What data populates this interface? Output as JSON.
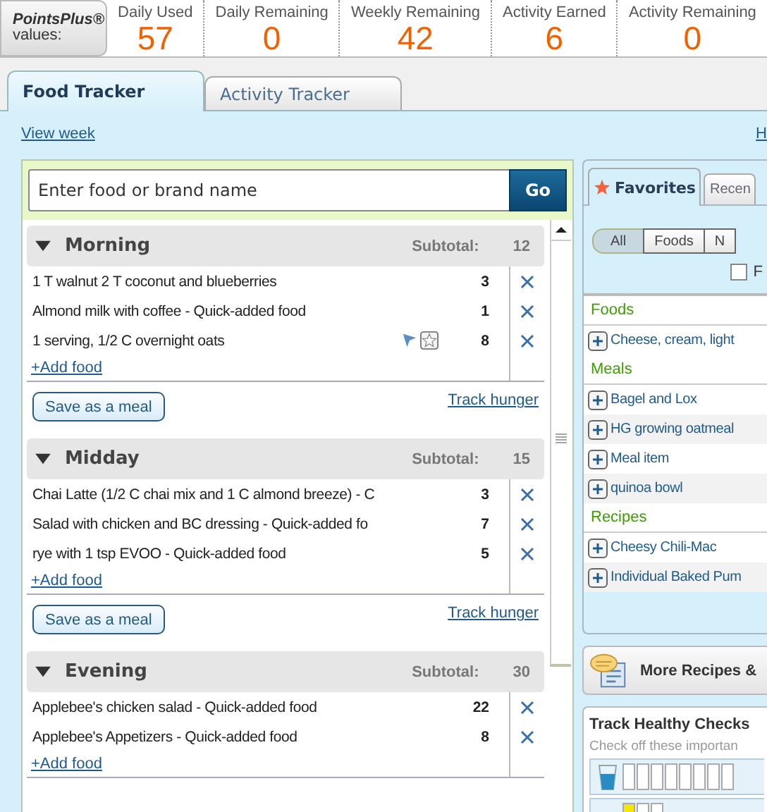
{
  "points_bar": {
    "brand": "PointsPlus®",
    "suffix": "values:",
    "stats": [
      {
        "label": "Daily Used",
        "value": "57"
      },
      {
        "label": "Daily Remaining",
        "value": "0"
      },
      {
        "label": "Weekly Remaining",
        "value": "42"
      },
      {
        "label": "Activity Earned",
        "value": "6"
      },
      {
        "label": "Activity Remaining",
        "value": "0"
      }
    ]
  },
  "tabs": [
    {
      "label": "Food Tracker",
      "selected": true
    },
    {
      "label": "Activity Tracker",
      "selected": false
    }
  ],
  "view_week_link": "View week",
  "right_link": "H",
  "search": {
    "placeholder": "Enter food or brand name",
    "button": "Go"
  },
  "meals": [
    {
      "name": "Morning",
      "expanded": true,
      "subtotal_label": "Subtotal:",
      "subtotal": "12",
      "items": [
        {
          "name": "1 T walnut 2 T coconut  and blueberries",
          "points": "3",
          "marked": false
        },
        {
          "name": "Almond milk with coffee - Quick-added food",
          "points": "1",
          "marked": false
        },
        {
          "name": "1 serving, 1/2 C overnight oats",
          "points": "8",
          "marked": true
        }
      ],
      "add_link": "+Add food",
      "save_button": "Save as a meal",
      "hunger_link": "Track hunger"
    },
    {
      "name": "Midday",
      "expanded": true,
      "subtotal_label": "Subtotal:",
      "subtotal": "15",
      "items": [
        {
          "name": "Chai Latte (1/2 C chai mix and 1 C almond breeze) - C",
          "points": "3",
          "marked": false
        },
        {
          "name": "Salad with chicken and BC dressing - Quick-added fo",
          "points": "7",
          "marked": false
        },
        {
          "name": "rye with 1 tsp EVOO - Quick-added food",
          "points": "5",
          "marked": false
        }
      ],
      "add_link": "+Add food",
      "save_button": "Save as a meal",
      "hunger_link": "Track hunger"
    },
    {
      "name": "Evening",
      "expanded": true,
      "subtotal_label": "Subtotal:",
      "subtotal": "30",
      "items": [
        {
          "name": "Applebee's chicken salad - Quick-added food",
          "points": "22",
          "marked": false
        },
        {
          "name": "Applebee's Appetizers - Quick-added food",
          "points": "8",
          "marked": false
        }
      ],
      "add_link": "+Add food"
    }
  ],
  "favorites": {
    "tabs": [
      {
        "label": "Favorites",
        "selected": true
      },
      {
        "label": "Recen",
        "selected": false
      }
    ],
    "filters": [
      {
        "label": "All",
        "selected": true
      },
      {
        "label": "Foods",
        "selected": false
      },
      {
        "label": "N",
        "selected": false
      }
    ],
    "checkbox": {
      "label": "F",
      "checked": false
    },
    "groups": [
      {
        "name": "Foods",
        "items": [
          "Cheese, cream, light"
        ]
      },
      {
        "name": "Meals",
        "items": [
          "Bagel and Lox",
          "HG growing oatmeal",
          "Meal item",
          "quinoa bowl"
        ]
      },
      {
        "name": "Recipes",
        "items": [
          "Cheesy Chili-Mac",
          "Individual Baked Pum"
        ]
      }
    ]
  },
  "more_recipes": "More Recipes &",
  "healthy_checks": {
    "title": "Track Healthy Checks",
    "hint": "Check off these importan"
  }
}
